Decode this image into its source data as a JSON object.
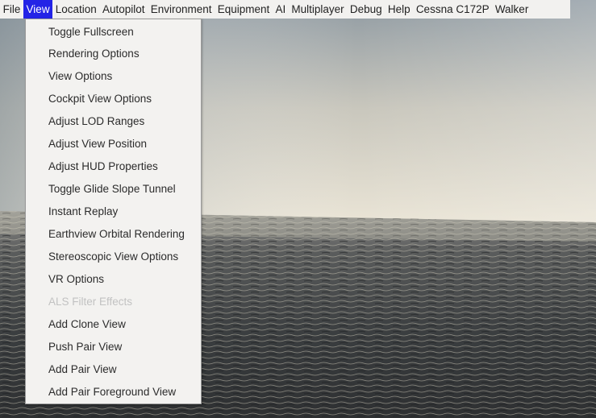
{
  "menubar": {
    "items": [
      {
        "label": "File"
      },
      {
        "label": "View",
        "active": true
      },
      {
        "label": "Location"
      },
      {
        "label": "Autopilot"
      },
      {
        "label": "Environment"
      },
      {
        "label": "Equipment"
      },
      {
        "label": "AI"
      },
      {
        "label": "Multiplayer"
      },
      {
        "label": "Debug"
      },
      {
        "label": "Help"
      },
      {
        "label": "Cessna C172P"
      },
      {
        "label": "Walker"
      }
    ]
  },
  "view_menu": {
    "items": [
      {
        "label": "Toggle Fullscreen",
        "enabled": true
      },
      {
        "label": "Rendering Options",
        "enabled": true
      },
      {
        "label": "View Options",
        "enabled": true
      },
      {
        "label": "Cockpit View Options",
        "enabled": true
      },
      {
        "label": "Adjust LOD Ranges",
        "enabled": true
      },
      {
        "label": "Adjust View Position",
        "enabled": true
      },
      {
        "label": "Adjust HUD Properties",
        "enabled": true
      },
      {
        "label": "Toggle Glide Slope Tunnel",
        "enabled": true
      },
      {
        "label": "Instant Replay",
        "enabled": true
      },
      {
        "label": "Earthview Orbital Rendering",
        "enabled": true
      },
      {
        "label": "Stereoscopic View Options",
        "enabled": true
      },
      {
        "label": "VR Options",
        "enabled": true
      },
      {
        "label": "ALS Filter Effects",
        "enabled": false
      },
      {
        "label": "Add Clone View",
        "enabled": true
      },
      {
        "label": "Push Pair View",
        "enabled": true
      },
      {
        "label": "Add Pair View",
        "enabled": true
      },
      {
        "label": "Add Pair Foreground View",
        "enabled": true
      }
    ]
  },
  "colors": {
    "menu_highlight": "#2323e6",
    "menubar_bg": "#f2f1ef",
    "dropdown_bg": "#f3f2f0",
    "disabled_text": "#c2c2c2"
  }
}
